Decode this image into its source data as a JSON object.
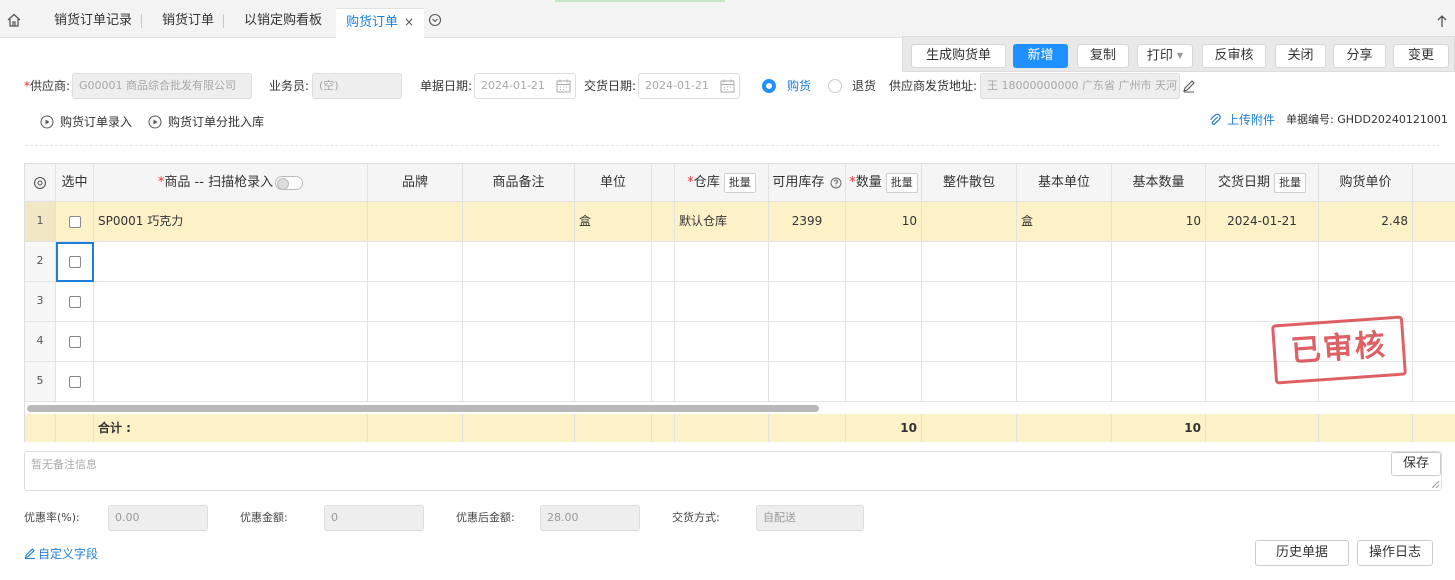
{
  "tabs": [
    {
      "label": "销货订单记录"
    },
    {
      "label": "销货订单"
    },
    {
      "label": "以销定购看板"
    },
    {
      "label": "购货订单",
      "close": "×"
    }
  ],
  "actions": {
    "generate": "生成购货单",
    "new": "新增",
    "copy": "复制",
    "print": "打印",
    "unaudit": "反审核",
    "close": "关闭",
    "share": "分享",
    "change": "变更"
  },
  "form": {
    "supplier_label": "供应商:",
    "supplier_value": "G00001 商品综合批发有限公司",
    "salesman_label": "业务员:",
    "salesman_value": "(空)",
    "doc_date_label": "单据日期:",
    "doc_date_value": "2024-01-21",
    "delivery_date_label": "交货日期:",
    "delivery_date_value": "2024-01-21",
    "radio_purchase": "购货",
    "radio_return": "退货",
    "address_label": "供应商发货地址:",
    "address_value": "王 18000000000 广东省 广州市 天河"
  },
  "subactions": {
    "entry": "购货订单录入",
    "batch": "购货订单分批入库",
    "upload": "上传附件",
    "doc_no": "单据编号: GHDD20240121001"
  },
  "table": {
    "headers": {
      "select": "选中",
      "product": "商品 -- 扫描枪录入",
      "brand": "品牌",
      "note": "商品备注",
      "unit": "单位",
      "warehouse": "仓库",
      "batch": "批量",
      "stock": "可用库存",
      "qty": "数量",
      "pack": "整件散包",
      "base_unit": "基本单位",
      "base_qty": "基本数量",
      "delivery": "交货日期",
      "price": "购货单价"
    },
    "row1": {
      "num": "1",
      "product": "SP0001 巧克力",
      "unit": "盒",
      "warehouse": "默认仓库",
      "stock": "2399",
      "qty": "10",
      "base_unit": "盒",
      "base_qty": "10",
      "delivery": "2024-01-21",
      "price": "2.48"
    },
    "row_nums": [
      "2",
      "3",
      "4",
      "5"
    ],
    "sum_label": "合计 :",
    "sum_qty": "10",
    "sum_base_qty": "10"
  },
  "stamp": "已审核",
  "remark": {
    "placeholder": "暂无备注信息",
    "save": "保存"
  },
  "footer": {
    "discount_rate_label": "优惠率(%):",
    "discount_rate_value": "0.00",
    "discount_amount_label": "优惠金额:",
    "discount_amount_value": "0",
    "after_discount_label": "优惠后金额:",
    "after_discount_value": "28.00",
    "delivery_method_label": "交货方式:",
    "delivery_method_value": "自配送",
    "custom_fields": "自定义字段",
    "history": "历史单据",
    "log": "操作日志"
  },
  "colors": {
    "accent": "#1e90ff",
    "highlight_row": "#fdf1c8",
    "stamp": "#d9454a"
  }
}
